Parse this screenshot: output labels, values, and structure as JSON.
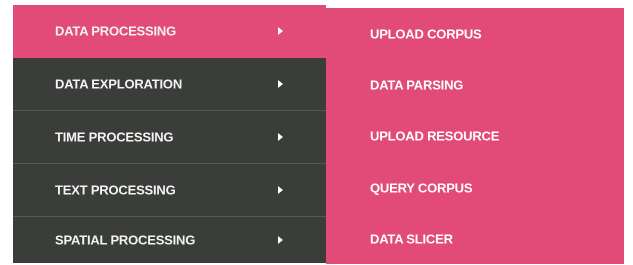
{
  "main_menu": {
    "items": [
      {
        "label": "DATA PROCESSING",
        "active": true
      },
      {
        "label": "DATA EXPLORATION",
        "active": false
      },
      {
        "label": "TIME PROCESSING",
        "active": false
      },
      {
        "label": "TEXT PROCESSING",
        "active": false
      },
      {
        "label": "SPATIAL PROCESSING",
        "active": false
      }
    ]
  },
  "submenu": {
    "items": [
      {
        "label": "UPLOAD CORPUS"
      },
      {
        "label": "DATA PARSING"
      },
      {
        "label": "UPLOAD RESOURCE"
      },
      {
        "label": "QUERY CORPUS"
      },
      {
        "label": "DATA SLICER"
      }
    ]
  },
  "colors": {
    "accent": "#e24a78",
    "menu_background": "#3a3d39",
    "menu_text": "#f3f3f3"
  },
  "icons": {
    "submenu_indicator": "chevron-right-icon"
  }
}
